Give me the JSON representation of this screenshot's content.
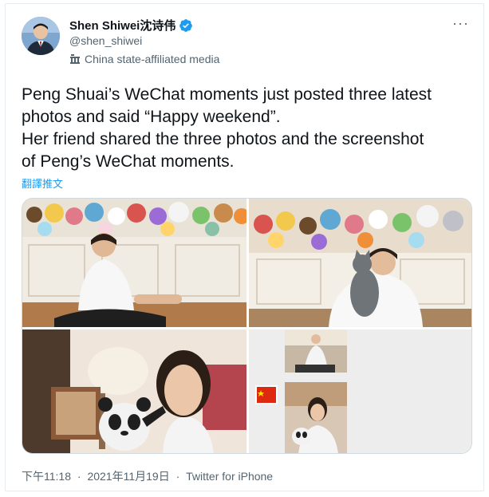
{
  "author": {
    "display_name": "Shen Shiwei沈诗伟",
    "handle": "@shen_shiwei",
    "affiliation": "China state-affiliated media",
    "verified": true,
    "avatar_icon": "avatar-photo",
    "affiliation_icon": "government-building-icon"
  },
  "more_menu_label": "···",
  "tweet": {
    "lines": [
      "Peng Shuai’s WeChat moments just posted three latest",
      "photos and said “Happy weekend”.",
      "Her friend shared the three photos and the screenshot",
      "of Peng’s WeChat moments."
    ],
    "translate_label": "翻譯推文"
  },
  "media": {
    "photos": [
      {
        "icon": "photo-sitting-floor-plush-toys"
      },
      {
        "icon": "photo-holding-cat-plush-toys"
      },
      {
        "icon": "photo-selfie-panda-toy"
      },
      {
        "icon": "photo-wechat-moments-screenshot"
      }
    ]
  },
  "meta": {
    "time": "下午11:18",
    "date": "2021年11月19日",
    "source": "Twitter for iPhone",
    "separator": "·"
  },
  "colors": {
    "accent": "#1d9bf0",
    "text": "#0f1419",
    "secondary": "#536471",
    "border": "#cfd9de"
  }
}
